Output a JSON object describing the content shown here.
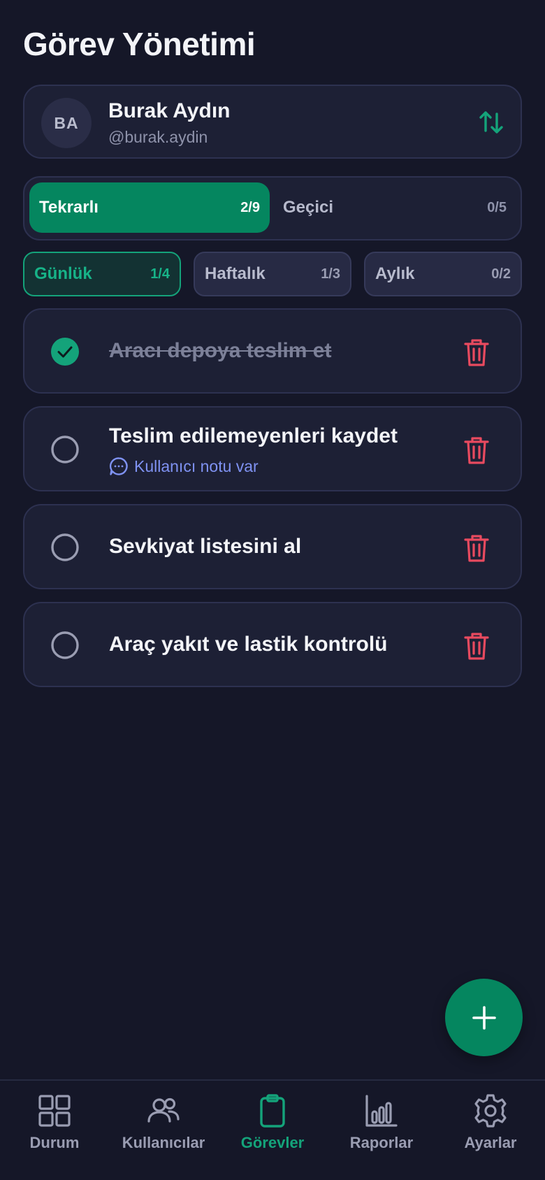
{
  "page": {
    "title": "Görev Yönetimi"
  },
  "profile": {
    "initials": "BA",
    "name": "Burak Aydın",
    "handle": "@burak.aydin"
  },
  "segments": [
    {
      "label": "Tekrarlı",
      "count": "2/9",
      "active": true
    },
    {
      "label": "Geçici",
      "count": "0/5",
      "active": false
    }
  ],
  "periods": [
    {
      "label": "Günlük",
      "count": "1/4",
      "active": true
    },
    {
      "label": "Haftalık",
      "count": "1/3",
      "active": false
    },
    {
      "label": "Aylık",
      "count": "0/2",
      "active": false
    }
  ],
  "tasks": [
    {
      "title": "Aracı depoya teslim et",
      "done": true
    },
    {
      "title": "Teslim edilemeyenleri kaydet",
      "done": false,
      "note": "Kullanıcı notu var"
    },
    {
      "title": "Sevkiyat listesini al",
      "done": false
    },
    {
      "title": "Araç yakıt ve lastik kontrolü",
      "done": false
    }
  ],
  "nav": [
    {
      "label": "Durum",
      "icon": "grid-icon",
      "active": false
    },
    {
      "label": "Kullanıcılar",
      "icon": "users-icon",
      "active": false
    },
    {
      "label": "Görevler",
      "icon": "clipboard-icon",
      "active": true
    },
    {
      "label": "Raporlar",
      "icon": "bar-chart-icon",
      "active": false
    },
    {
      "label": "Ayarlar",
      "icon": "gear-icon",
      "active": false
    }
  ],
  "colors": {
    "background": "#151728",
    "card": "#1d2035",
    "accent": "#05865f",
    "accent_text": "#14a37a",
    "danger": "#e84a5f",
    "note": "#7f92f2"
  }
}
